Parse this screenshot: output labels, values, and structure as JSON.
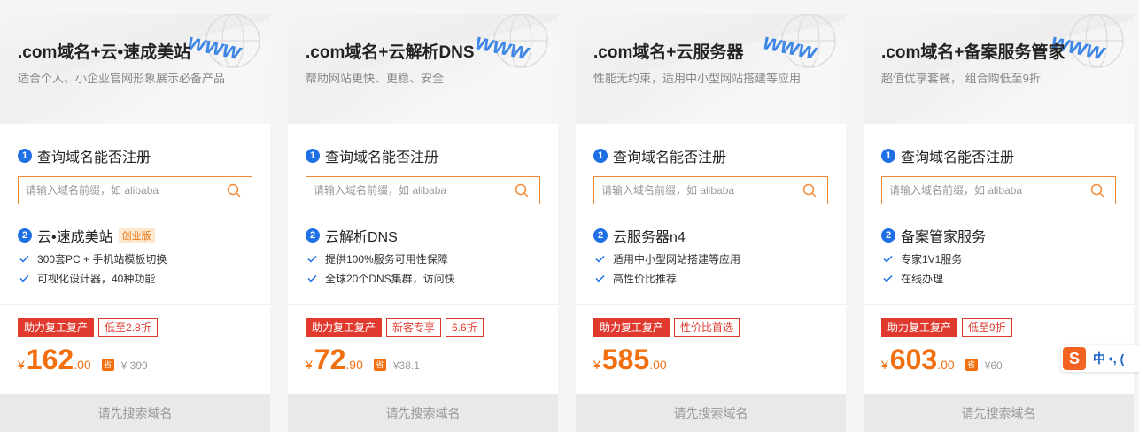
{
  "cards": [
    {
      "title": ".com域名+云•速成美站",
      "subtitle": "适合个人、小企业官网形象展示必备产品",
      "step1_num": "1",
      "step1_label": "查询域名能否注册",
      "search_placeholder": "请输入域名前缀，如 alibaba",
      "step2_num": "2",
      "step2_label": "云•速成美站",
      "step2_tag": "创业版",
      "features": [
        "300套PC + 手机站模板切换",
        "可视化设计器，40种功能"
      ],
      "promos": [
        {
          "text": "助力复工复产",
          "style": "filled"
        },
        {
          "text": "低至2.8折",
          "style": "outline"
        }
      ],
      "currency": "¥",
      "price_int": "162",
      "price_dec": ".00",
      "save_icon_text": "省",
      "original_price": "¥ 399",
      "button_label": "请先搜索域名"
    },
    {
      "title": ".com域名+云解析DNS",
      "subtitle": "帮助网站更快、更稳、安全",
      "step1_num": "1",
      "step1_label": "查询域名能否注册",
      "search_placeholder": "请输入域名前缀，如 alibaba",
      "step2_num": "2",
      "step2_label": "云解析DNS",
      "features": [
        "提供100%服务可用性保障",
        "全球20个DNS集群，访问快"
      ],
      "promos": [
        {
          "text": "助力复工复产",
          "style": "filled"
        },
        {
          "text": "新客专享",
          "style": "outline"
        },
        {
          "text": "6.6折",
          "style": "outline"
        }
      ],
      "currency": "¥",
      "price_int": "72",
      "price_dec": ".90",
      "save_icon_text": "省",
      "original_price": "¥38.1",
      "button_label": "请先搜索域名"
    },
    {
      "title": ".com域名+云服务器",
      "subtitle": "性能无约束，适用中小型网站搭建等应用",
      "step1_num": "1",
      "step1_label": "查询域名能否注册",
      "search_placeholder": "请输入域名前缀，如 alibaba",
      "step2_num": "2",
      "step2_label": "云服务器n4",
      "features": [
        "适用中小型网站搭建等应用",
        "高性价比推荐"
      ],
      "promos": [
        {
          "text": "助力复工复产",
          "style": "filled"
        },
        {
          "text": "性价比首选",
          "style": "outline"
        }
      ],
      "currency": "¥",
      "price_int": "585",
      "price_dec": ".00",
      "button_label": "请先搜索域名"
    },
    {
      "title": ".com域名+备案服务管家",
      "subtitle": "超值优享套餐， 组合购低至9折",
      "step1_num": "1",
      "step1_label": "查询域名能否注册",
      "search_placeholder": "请输入域名前缀，如 alibaba",
      "step2_num": "2",
      "step2_label": "备案管家服务",
      "features": [
        "专家1V1服务",
        "在线办理"
      ],
      "promos": [
        {
          "text": "助力复工复产",
          "style": "filled"
        },
        {
          "text": "低至9折",
          "style": "outline"
        }
      ],
      "currency": "¥",
      "price_int": "603",
      "price_dec": ".00",
      "save_icon_text": "省",
      "original_price": "¥60",
      "button_label": "请先搜索域名"
    }
  ],
  "decoration": {
    "www_text": "www"
  },
  "ime_toolbar": {
    "logo": "S",
    "text": "中 •, ("
  },
  "colors": {
    "accent_orange": "#f26f0f",
    "promo_red": "#e03a2f",
    "step_blue": "#1f6fe5",
    "search_border": "#f08a36"
  }
}
